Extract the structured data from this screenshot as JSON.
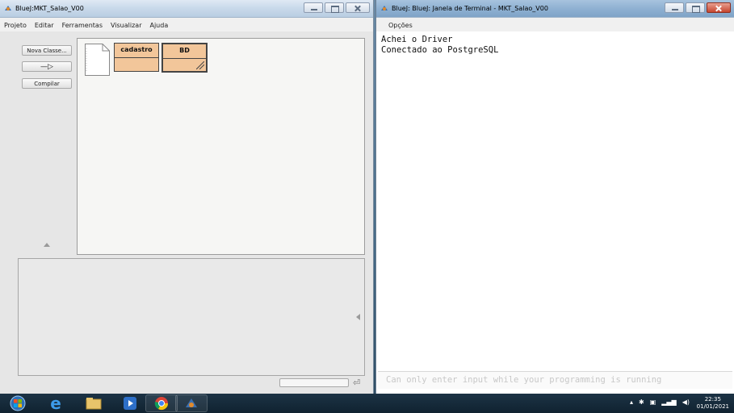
{
  "left_window": {
    "title": "BlueJ:MKT_Salao_V00",
    "menu": [
      "Projeto",
      "Editar",
      "Ferramentas",
      "Visualizar",
      "Ajuda"
    ],
    "sidebar": {
      "new_class_label": "Nova Classe...",
      "arrow_label": "—▷",
      "compile_label": "Compilar"
    },
    "classes": [
      {
        "name": "cadastro"
      },
      {
        "name": "BD"
      }
    ],
    "icons": {
      "app": "bluej-icon",
      "readme": "readme-document-icon",
      "up": "triangle-up-icon",
      "left": "triangle-left-icon",
      "enter": "enter-key-icon"
    }
  },
  "right_window": {
    "title": "BlueJ: BlueJ: Janela de Terminal - MKT_Salao_V00",
    "menu_label": "Opções",
    "output_lines": [
      "Achei o Driver",
      "Conectado ao PostgreSQL"
    ],
    "input_placeholder": "Can only enter input while your programming is running"
  },
  "taskbar": {
    "apps": [
      "windows-start-icon",
      "internet-explorer-icon",
      "file-explorer-icon",
      "media-player-icon",
      "chrome-icon",
      "bluej-icon"
    ],
    "tray": [
      "chevron-up-icon",
      "bluetooth-icon",
      "network-icon",
      "signal-icon",
      "volume-icon"
    ],
    "time": "22:35",
    "date": "01/01/2021"
  }
}
